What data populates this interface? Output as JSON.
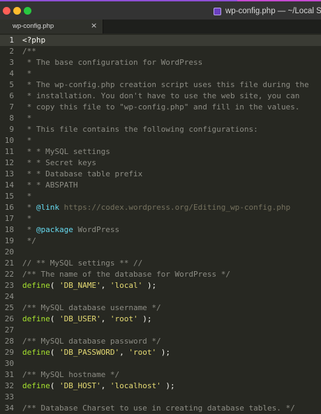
{
  "window": {
    "title": "wp-config.php — ~/Local Sit",
    "colors": {
      "close": "#ff5f57",
      "minimize": "#febc2e",
      "zoom": "#28c840"
    }
  },
  "tab": {
    "label": "wp-config.php",
    "close_glyph": "×"
  },
  "editor": {
    "syntax_colors": {
      "comment": "#8c8c84",
      "function": "#a6e22e",
      "string": "#e6db74",
      "doc_tag": "#66d9ef"
    },
    "lines": [
      {
        "n": "1",
        "tokens": [
          {
            "t": "<?php",
            "c": "punct"
          }
        ]
      },
      {
        "n": "2",
        "tokens": [
          {
            "t": "/**",
            "c": "comment"
          }
        ]
      },
      {
        "n": "3",
        "tokens": [
          {
            "t": " * The base configuration for WordPress",
            "c": "comment"
          }
        ]
      },
      {
        "n": "4",
        "tokens": [
          {
            "t": " *",
            "c": "comment"
          }
        ]
      },
      {
        "n": "5",
        "tokens": [
          {
            "t": " * The wp-config.php creation script uses this file during the",
            "c": "comment"
          }
        ]
      },
      {
        "n": "6",
        "tokens": [
          {
            "t": " * installation. You don't have to use the web site, you can",
            "c": "comment"
          }
        ]
      },
      {
        "n": "7",
        "tokens": [
          {
            "t": " * copy this file to \"wp-config.php\" and fill in the values.",
            "c": "comment"
          }
        ]
      },
      {
        "n": "8",
        "tokens": [
          {
            "t": " *",
            "c": "comment"
          }
        ]
      },
      {
        "n": "9",
        "tokens": [
          {
            "t": " * This file contains the following configurations:",
            "c": "comment"
          }
        ]
      },
      {
        "n": "10",
        "tokens": [
          {
            "t": " *",
            "c": "comment"
          }
        ]
      },
      {
        "n": "11",
        "tokens": [
          {
            "t": " * * MySQL settings",
            "c": "comment"
          }
        ]
      },
      {
        "n": "12",
        "tokens": [
          {
            "t": " * * Secret keys",
            "c": "comment"
          }
        ]
      },
      {
        "n": "13",
        "tokens": [
          {
            "t": " * * Database table prefix",
            "c": "comment"
          }
        ]
      },
      {
        "n": "14",
        "tokens": [
          {
            "t": " * * ABSPATH",
            "c": "comment"
          }
        ]
      },
      {
        "n": "15",
        "tokens": [
          {
            "t": " *",
            "c": "comment"
          }
        ]
      },
      {
        "n": "16",
        "tokens": [
          {
            "t": " * ",
            "c": "comment"
          },
          {
            "t": "@link",
            "c": "tag"
          },
          {
            "t": " https://codex.wordpress.org/Editing_wp-config.php",
            "c": "url"
          }
        ]
      },
      {
        "n": "17",
        "tokens": [
          {
            "t": " *",
            "c": "comment"
          }
        ]
      },
      {
        "n": "18",
        "tokens": [
          {
            "t": " * ",
            "c": "comment"
          },
          {
            "t": "@package",
            "c": "tag"
          },
          {
            "t": " WordPress",
            "c": "comment"
          }
        ]
      },
      {
        "n": "19",
        "tokens": [
          {
            "t": " */",
            "c": "comment"
          }
        ]
      },
      {
        "n": "20",
        "tokens": [
          {
            "t": "",
            "c": "punct"
          }
        ]
      },
      {
        "n": "21",
        "tokens": [
          {
            "t": "// ** MySQL settings ** //",
            "c": "comment"
          }
        ]
      },
      {
        "n": "22",
        "tokens": [
          {
            "t": "/** The name of the database for WordPress */",
            "c": "comment"
          }
        ]
      },
      {
        "n": "23",
        "tokens": [
          {
            "t": "define",
            "c": "kw"
          },
          {
            "t": "( ",
            "c": "punct"
          },
          {
            "t": "'DB_NAME'",
            "c": "str"
          },
          {
            "t": ", ",
            "c": "punct"
          },
          {
            "t": "'local'",
            "c": "str"
          },
          {
            "t": " );",
            "c": "punct"
          }
        ]
      },
      {
        "n": "24",
        "tokens": [
          {
            "t": "",
            "c": "punct"
          }
        ]
      },
      {
        "n": "25",
        "tokens": [
          {
            "t": "/** MySQL database username */",
            "c": "comment"
          }
        ]
      },
      {
        "n": "26",
        "tokens": [
          {
            "t": "define",
            "c": "kw"
          },
          {
            "t": "( ",
            "c": "punct"
          },
          {
            "t": "'DB_USER'",
            "c": "str"
          },
          {
            "t": ", ",
            "c": "punct"
          },
          {
            "t": "'root'",
            "c": "str"
          },
          {
            "t": " );",
            "c": "punct"
          }
        ]
      },
      {
        "n": "27",
        "tokens": [
          {
            "t": "",
            "c": "punct"
          }
        ]
      },
      {
        "n": "28",
        "tokens": [
          {
            "t": "/** MySQL database password */",
            "c": "comment"
          }
        ]
      },
      {
        "n": "29",
        "tokens": [
          {
            "t": "define",
            "c": "kw"
          },
          {
            "t": "( ",
            "c": "punct"
          },
          {
            "t": "'DB_PASSWORD'",
            "c": "str"
          },
          {
            "t": ", ",
            "c": "punct"
          },
          {
            "t": "'root'",
            "c": "str"
          },
          {
            "t": " );",
            "c": "punct"
          }
        ]
      },
      {
        "n": "30",
        "tokens": [
          {
            "t": "",
            "c": "punct"
          }
        ]
      },
      {
        "n": "31",
        "tokens": [
          {
            "t": "/** MySQL hostname */",
            "c": "comment"
          }
        ]
      },
      {
        "n": "32",
        "tokens": [
          {
            "t": "define",
            "c": "kw"
          },
          {
            "t": "( ",
            "c": "punct"
          },
          {
            "t": "'DB_HOST'",
            "c": "str"
          },
          {
            "t": ", ",
            "c": "punct"
          },
          {
            "t": "'localhost'",
            "c": "str"
          },
          {
            "t": " );",
            "c": "punct"
          }
        ]
      },
      {
        "n": "33",
        "tokens": [
          {
            "t": "",
            "c": "punct"
          }
        ]
      },
      {
        "n": "34",
        "tokens": [
          {
            "t": "/** Database Charset to use in creating database tables. */",
            "c": "comment"
          }
        ]
      }
    ]
  }
}
